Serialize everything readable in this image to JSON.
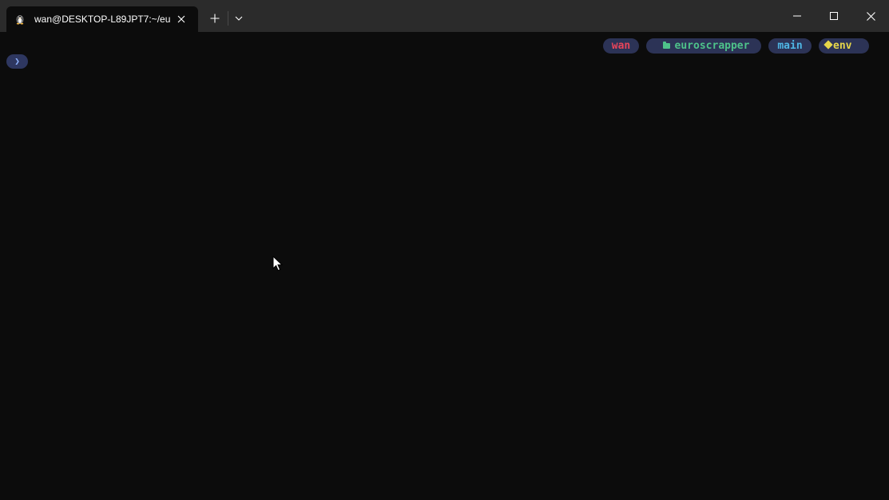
{
  "tab": {
    "icon": "linux-penguin-icon",
    "title": "wan@DESKTOP-L89JPT7:~/eu"
  },
  "titlebar": {
    "new_tab_icon": "plus-icon",
    "dropdown_icon": "chevron-down-icon",
    "minimize_icon": "minimize-icon",
    "maximize_icon": "maximize-icon",
    "close_icon": "close-icon"
  },
  "terminal": {
    "prompt_symbol": "❯",
    "status_segments": {
      "user": "wan",
      "directory": "euroscrapper",
      "branch": "main",
      "env": "env"
    }
  },
  "colors": {
    "titlebar_bg": "#2b2b2b",
    "terminal_bg": "#0c0c0c",
    "segment_bg": "#2c3356",
    "user": "#e8455a",
    "directory": "#4ec28a",
    "branch": "#4fb7e6",
    "env": "#e6d64a"
  }
}
